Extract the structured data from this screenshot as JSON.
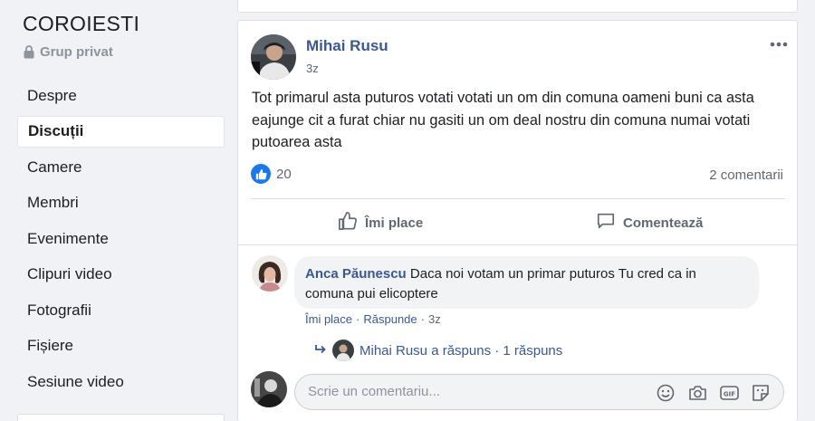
{
  "sidebar": {
    "group_name": "COROIESTI",
    "privacy": "Grup privat",
    "items": [
      {
        "label": "Despre"
      },
      {
        "label": "Discuții"
      },
      {
        "label": "Camere"
      },
      {
        "label": "Membri"
      },
      {
        "label": "Evenimente"
      },
      {
        "label": "Clipuri video"
      },
      {
        "label": "Fotografii"
      },
      {
        "label": "Fișiere"
      },
      {
        "label": "Sesiune video"
      }
    ],
    "active_index": 1
  },
  "post": {
    "author": "Mihai Rusu",
    "time": "3z",
    "text": "Tot primarul asta puturos votati votati un om din comuna oameni buni ca asta eajunge cit a furat chiar nu gasiti un om deal nostru din comuna numai votati putoarea asta",
    "reaction_count": "20",
    "comments_count": "2 comentarii",
    "like_label": "Îmi place",
    "comment_label": "Comentează"
  },
  "comment": {
    "author": "Anca Păunescu",
    "text": "Daca noi votam un primar puturos Tu cred ca in comuna pui elicoptere",
    "like_label": "Îmi place",
    "reply_label": "Răspunde",
    "time": "3z",
    "replies_text": "Mihai Rusu a răspuns · 1 răspuns"
  },
  "composer": {
    "placeholder": "Scrie un comentariu..."
  },
  "colors": {
    "link": "#385898",
    "like_blue": "#1877f2",
    "muted": "#606770",
    "background": "#f0f2f5"
  },
  "icons": [
    "lock-icon",
    "more-icon",
    "like-reaction-icon",
    "thumbs-up-icon",
    "comment-icon",
    "reply-arrow-icon",
    "emoji-icon",
    "camera-icon",
    "gif-icon",
    "sticker-icon"
  ]
}
